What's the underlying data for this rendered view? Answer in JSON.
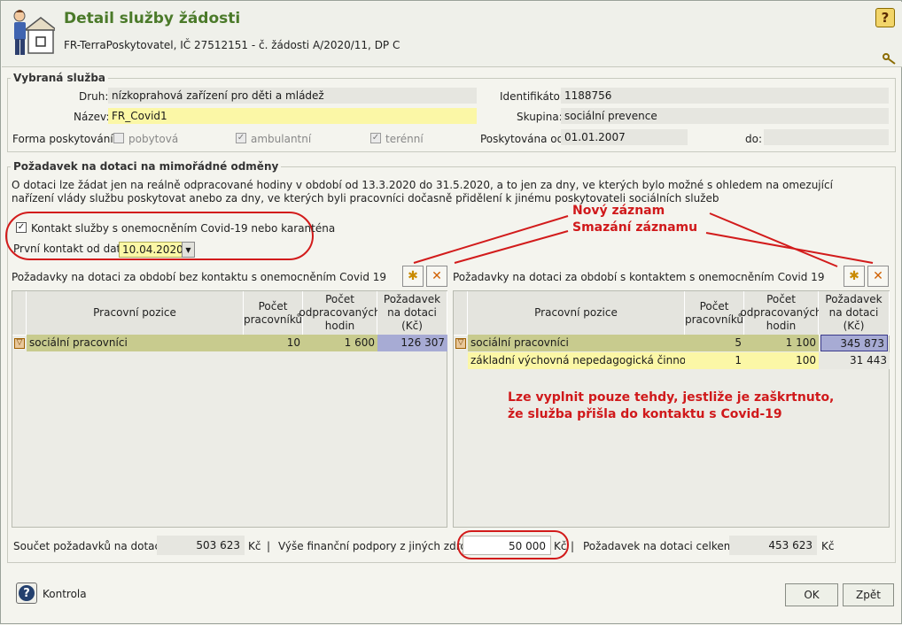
{
  "header": {
    "title": "Detail služby žádosti",
    "subtitle": "FR-TerraPoskytovatel, IČ 27512151 - č. žádosti A/2020/11, DP C",
    "help_icon": "question-icon",
    "pin_icon": "key-icon"
  },
  "service": {
    "legend": "Vybraná služba",
    "druh_label": "Druh:",
    "druh_value": "nízkoprahová zařízení pro děti a mládež",
    "nazev_label": "Název:",
    "nazev_value": "FR_Covid1",
    "identifikator_label": "Identifikátor:",
    "identifikator_value": "1188756",
    "skupina_label": "Skupina:",
    "skupina_value": "sociální prevence",
    "forma_label": "Forma poskytování:",
    "forma_options": [
      {
        "label": "pobytová",
        "checked": false
      },
      {
        "label": "ambulantní",
        "checked": true
      },
      {
        "label": "terénní",
        "checked": true
      }
    ],
    "poskytovana_od_label": "Poskytována od:",
    "poskytovana_od_value": "01.01.2007",
    "do_label": "do:",
    "do_value": ""
  },
  "request": {
    "legend": "Požadavek na dotaci na mimořádné odměny",
    "description": "O dotaci lze žádat jen na reálně odpracované hodiny v období od 13.3.2020 do 31.5.2020, a to jen za dny, ve kterých bylo možné s ohledem na omezující nařízení vlády službu poskytovat anebo za dny, ve kterých byli pracovníci dočasně přidělení k jinému poskytovateli sociálních služeb",
    "contact_checkbox_label": "Kontakt služby s onemocněním Covid-19 nebo karanténa",
    "contact_checked": true,
    "first_contact_label": "První kontakt od data:",
    "first_contact_value": "10.04.2020"
  },
  "annotations": {
    "new_record": "Nový záznam",
    "delete_record": "Smazání záznamu",
    "note_line1": "Lze vyplnit pouze tehdy, jestliže je zaškrtnuto,",
    "note_line2": "že služba přišla do kontaktu s Covid-19"
  },
  "table_left": {
    "caption": "Požadavky na dotaci za období bez kontaktu s onemocněním Covid 19",
    "headers": [
      "Pracovní pozice",
      "Počet pracovníků",
      "Počet odpracovaných hodin",
      "Požadavek na dotaci (Kč)"
    ],
    "rows": [
      {
        "pozice": "sociální pracovníci",
        "pocet": "10",
        "hodin": "1 600",
        "pozadavek": "126 307"
      }
    ]
  },
  "table_right": {
    "caption": "Požadavky na dotaci za období s kontaktem s onemocněním Covid 19",
    "headers": [
      "Pracovní pozice",
      "Počet pracovníků",
      "Počet odpracovaných hodin",
      "Požadavek na dotaci (Kč)"
    ],
    "rows": [
      {
        "pozice": "sociální pracovníci",
        "pocet": "5",
        "hodin": "1 100",
        "pozadavek": "345 873"
      },
      {
        "pozice": "základní výchovná nepedagogická činnost",
        "pocet": "1",
        "hodin": "100",
        "pozadavek": "31 443"
      }
    ]
  },
  "totals": {
    "soucet_label": "Součet požadavků na dotaci:",
    "soucet_value": "503 623",
    "currency": "Kč",
    "sep": "|",
    "vyse_label": "Výše finanční podpory z jiných zdrojů:",
    "vyse_value": "50 000",
    "celkem_label": "Požadavek na dotaci celkem:",
    "celkem_value": "453 623"
  },
  "footer": {
    "kontrola_label": "Kontrola",
    "ok_label": "OK",
    "zpet_label": "Zpět"
  }
}
